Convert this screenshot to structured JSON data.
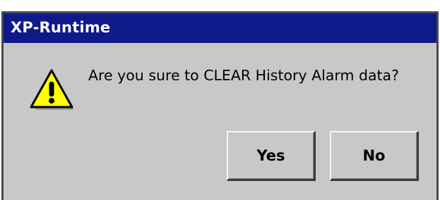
{
  "dialog": {
    "title": "XP-Runtime",
    "message": "Are you sure to CLEAR History Alarm data?",
    "icon": "warning-icon",
    "buttons": {
      "yes_label": "Yes",
      "no_label": "No"
    }
  },
  "colors": {
    "titlebar": "#0e1a8a",
    "title_text": "#ffffff",
    "dialog_background": "#c8c8c8",
    "icon_fill": "#ffff00",
    "icon_outline": "#000000"
  }
}
